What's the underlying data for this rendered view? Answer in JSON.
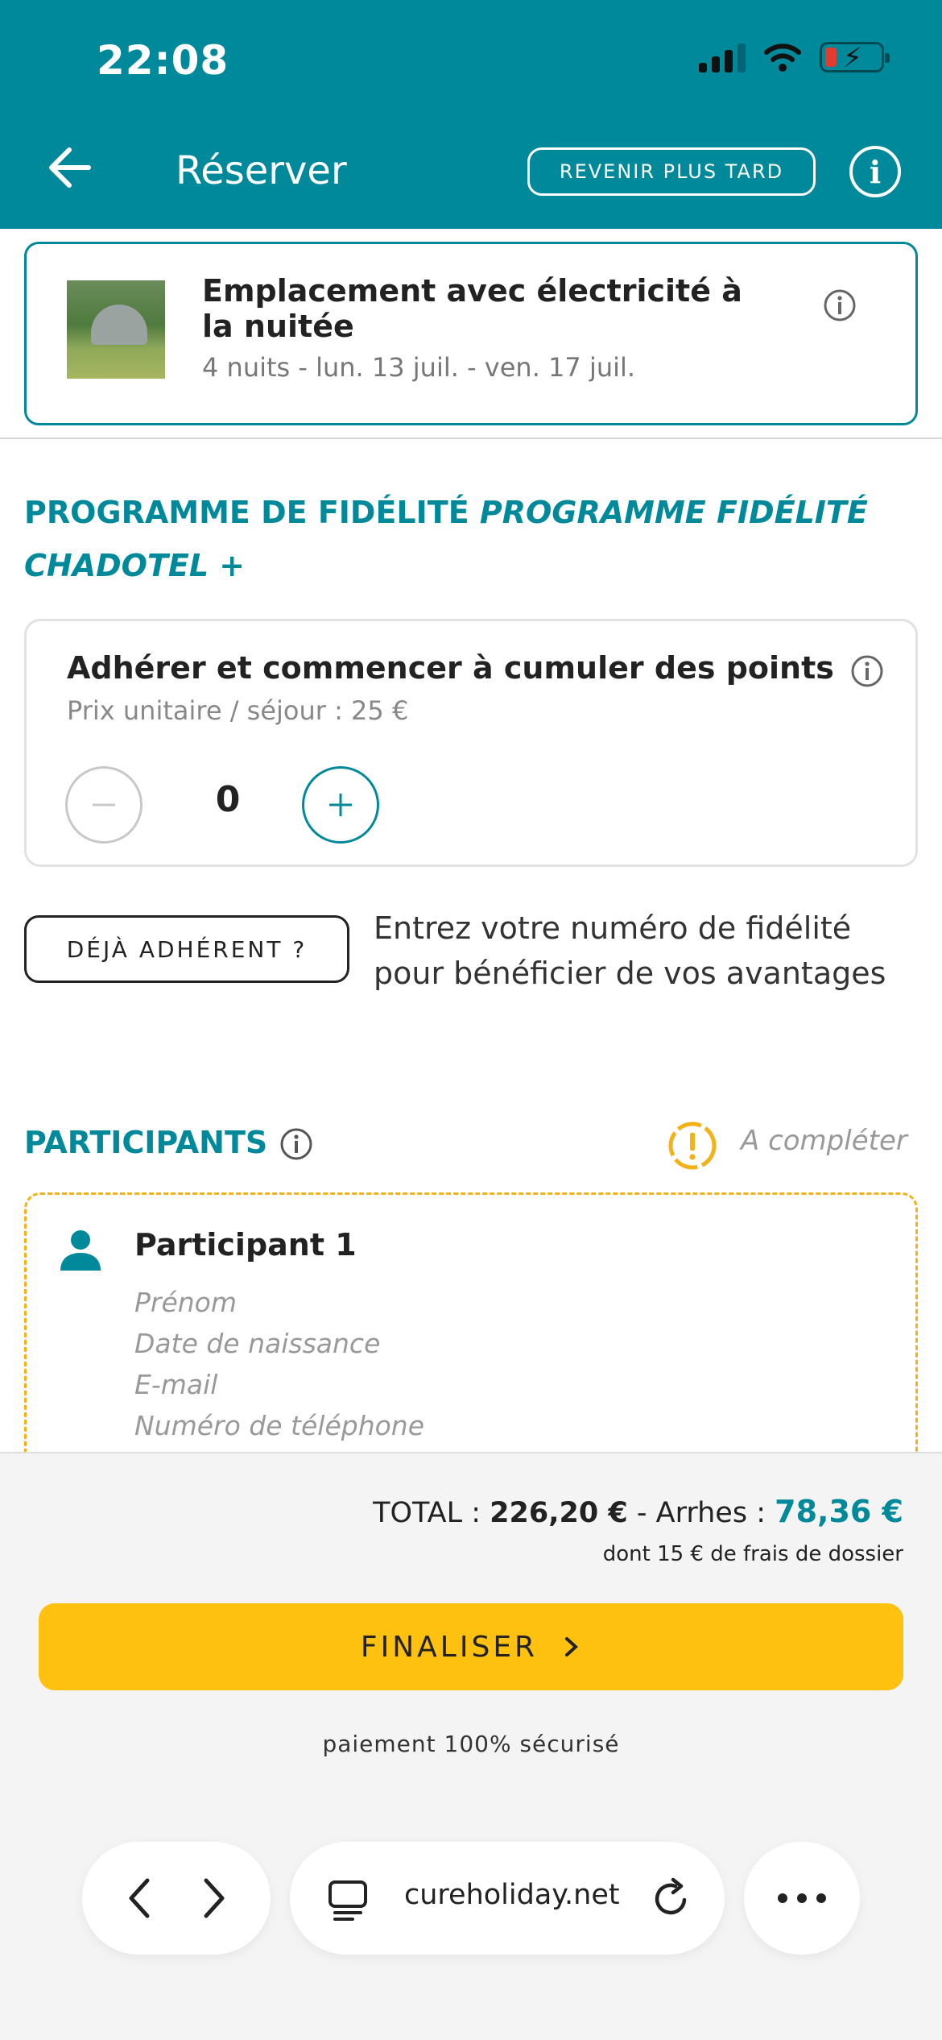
{
  "status_bar": {
    "time": "22:08"
  },
  "header": {
    "title": "Réserver",
    "later_label": "REVENIR PLUS TARD"
  },
  "product": {
    "title": "Emplacement avec électricité à la nuitée",
    "dates": "4 nuits  - lun. 13 juil. - ven. 17 juil."
  },
  "loyalty": {
    "title_main": "PROGRAMME DE FIDÉLITÉ ",
    "title_italic": "PROGRAMME FIDÉLITÉ CHADOTEL +",
    "heading": "Adhérer et commencer à cumuler des points",
    "unit_price": "Prix unitaire / séjour : 25 €",
    "quantity": "0",
    "member_button": "DÉJÀ ADHÉRENT ?",
    "member_text": "Entrez votre numéro de fidélité pour bénéficier de vos avantages"
  },
  "participants": {
    "title": "PARTICIPANTS",
    "status": "A compléter",
    "items": [
      {
        "name": "Participant 1",
        "fields": [
          "Prénom",
          "Date de naissance",
          "E-mail",
          "Numéro de téléphone"
        ]
      }
    ]
  },
  "summary": {
    "total_label": "TOTAL : ",
    "total_amount": "226,20 €",
    "deposit_label": " - Arrhes : ",
    "deposit_amount": "78,36 €",
    "fees": "dont 15 € de frais de dossier",
    "finalize": "FINALISER",
    "secure": "paiement 100% sécurisé"
  },
  "browser": {
    "url": "cureholiday.net"
  },
  "colors": {
    "primary": "#00899a",
    "accent": "#fec10f",
    "warning": "#f2b218"
  }
}
